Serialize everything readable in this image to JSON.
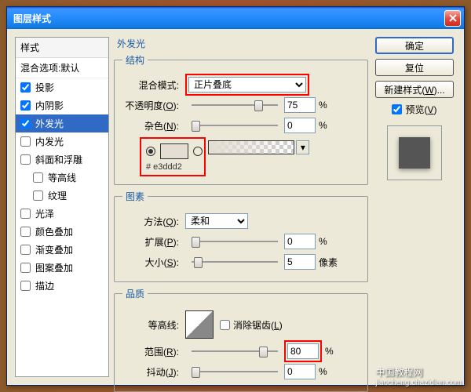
{
  "window": {
    "title": "图层样式"
  },
  "sidebar": {
    "header": "样式",
    "blend_opts": "混合选项:默认",
    "items": [
      {
        "label": "投影",
        "checked": true,
        "selected": false,
        "indent": false
      },
      {
        "label": "内阴影",
        "checked": true,
        "selected": false,
        "indent": false
      },
      {
        "label": "外发光",
        "checked": true,
        "selected": true,
        "indent": false
      },
      {
        "label": "内发光",
        "checked": false,
        "selected": false,
        "indent": false
      },
      {
        "label": "斜面和浮雕",
        "checked": false,
        "selected": false,
        "indent": false
      },
      {
        "label": "等高线",
        "checked": false,
        "selected": false,
        "indent": true
      },
      {
        "label": "纹理",
        "checked": false,
        "selected": false,
        "indent": true
      },
      {
        "label": "光泽",
        "checked": false,
        "selected": false,
        "indent": false
      },
      {
        "label": "颜色叠加",
        "checked": false,
        "selected": false,
        "indent": false
      },
      {
        "label": "渐变叠加",
        "checked": false,
        "selected": false,
        "indent": false
      },
      {
        "label": "图案叠加",
        "checked": false,
        "selected": false,
        "indent": false
      },
      {
        "label": "描边",
        "checked": false,
        "selected": false,
        "indent": false
      }
    ]
  },
  "main": {
    "title": "外发光",
    "structure": {
      "legend": "结构",
      "blend_mode": {
        "label": "混合模式:",
        "value": "正片叠底"
      },
      "opacity": {
        "label_prefix": "不透明度(",
        "underline": "O",
        "label_suffix": "):",
        "value": "75",
        "unit": "%",
        "thumb_pct": 73
      },
      "noise": {
        "label_prefix": "杂色(",
        "underline": "N",
        "label_suffix": "):",
        "value": "0",
        "unit": "%",
        "thumb_pct": 0
      },
      "color_hex": "# e3ddd2"
    },
    "element": {
      "legend": "图素",
      "technique": {
        "label_prefix": "方法(",
        "underline": "Q",
        "label_suffix": "):",
        "value": "柔和"
      },
      "spread": {
        "label_prefix": "扩展(",
        "underline": "P",
        "label_suffix": "):",
        "value": "0",
        "unit": "%",
        "thumb_pct": 0
      },
      "size": {
        "label_prefix": "大小(",
        "underline": "S",
        "label_suffix": "):",
        "value": "5",
        "unit": "像素",
        "thumb_pct": 3
      }
    },
    "quality": {
      "legend": "品质",
      "contour_label": "等高线:",
      "antialias": {
        "label_prefix": "消除锯齿(",
        "underline": "L",
        "label_suffix": ")",
        "checked": false
      },
      "range": {
        "label_prefix": "范围(",
        "underline": "R",
        "label_suffix": "):",
        "value": "80",
        "unit": "%",
        "thumb_pct": 78
      },
      "jitter": {
        "label_prefix": "抖动(",
        "underline": "J",
        "label_suffix": "):",
        "value": "0",
        "unit": "%",
        "thumb_pct": 0
      }
    }
  },
  "buttons": {
    "ok": "确定",
    "cancel": "复位",
    "new_style_prefix": "新建样式(",
    "new_style_underline": "W",
    "new_style_suffix": ")...",
    "preview_prefix": "预览(",
    "preview_underline": "V",
    "preview_suffix": ")"
  },
  "watermark": {
    "line1": "中国教程网",
    "line2": "jiaocheng.chazidian.com"
  }
}
